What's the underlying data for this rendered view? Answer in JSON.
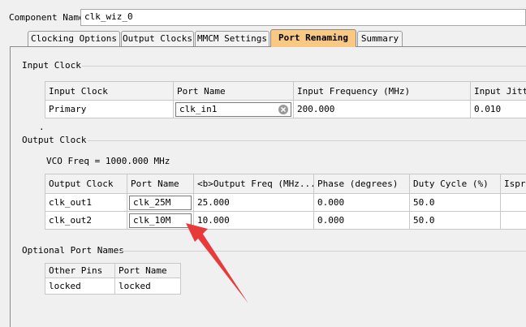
{
  "component": {
    "label": "Component Name",
    "value": "clk_wiz_0"
  },
  "tabs": [
    {
      "label": "Clocking Options"
    },
    {
      "label": "Output Clocks"
    },
    {
      "label": "MMCM Settings"
    },
    {
      "label": "Port Renaming"
    },
    {
      "label": "Summary"
    }
  ],
  "active_tab": "Port Renaming",
  "input_clock": {
    "title": "Input Clock",
    "headers": [
      "Input Clock",
      "Port Name",
      "Input Frequency (MHz)",
      "Input Jitte"
    ],
    "row": {
      "clock": "Primary",
      "port": "clk_in1",
      "freq": "200.000",
      "jitter": "0.010"
    },
    "dot": "."
  },
  "output_clock": {
    "title": "Output Clock",
    "vco": "VCO Freq = 1000.000 MHz",
    "headers": [
      "Output Clock",
      "Port Name",
      "<b>Output Freq (MHz...",
      "Phase (degrees)",
      "Duty Cycle (%)",
      "Ispre"
    ],
    "rows": [
      {
        "clock": "clk_out1",
        "port": "clk_25M",
        "freq": "25.000",
        "phase": "0.000",
        "duty": "50.0"
      },
      {
        "clock": "clk_out2",
        "port": "clk_10M",
        "freq": "10.000",
        "phase": "0.000",
        "duty": "50.0"
      }
    ]
  },
  "optional_ports": {
    "title": "Optional Port Names",
    "headers": [
      "Other Pins",
      "Port Name"
    ],
    "row": {
      "pin": "locked",
      "port": "locked"
    }
  },
  "colors": {
    "active_tab": "#f9c882",
    "annotation_arrow": "#e8393b"
  }
}
